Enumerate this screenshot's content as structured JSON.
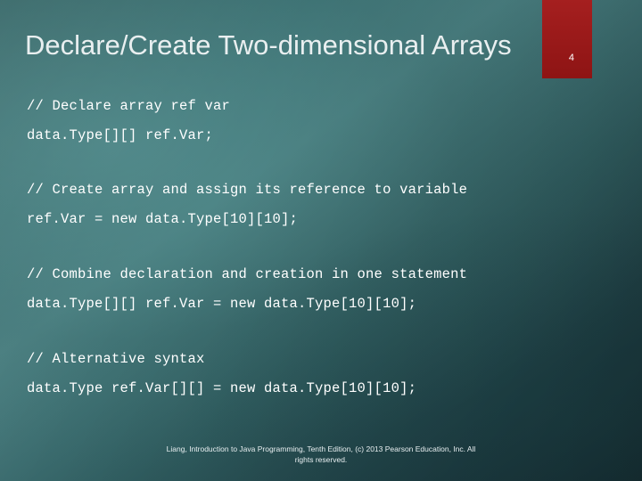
{
  "slide": {
    "title": "Declare/Create Two-dimensional Arrays",
    "page_number": "4",
    "accent_color": "#9e1b1b",
    "background_color": "#3d7274",
    "code_blocks": [
      {
        "lines": [
          "// Declare array ref var",
          "data.Type[][] ref.Var;"
        ]
      },
      {
        "lines": [
          "// Create array and assign its reference to variable",
          "ref.Var = new data.Type[10][10];"
        ]
      },
      {
        "lines": [
          "// Combine declaration and creation in one statement",
          "data.Type[][] ref.Var = new data.Type[10][10];"
        ]
      },
      {
        "lines": [
          "// Alternative syntax",
          "data.Type ref.Var[][] = new data.Type[10][10];"
        ]
      }
    ],
    "footer": {
      "line1": "Liang, Introduction to Java Programming, Tenth Edition, (c) 2013 Pearson Education, Inc. All",
      "line2": "rights reserved."
    }
  }
}
